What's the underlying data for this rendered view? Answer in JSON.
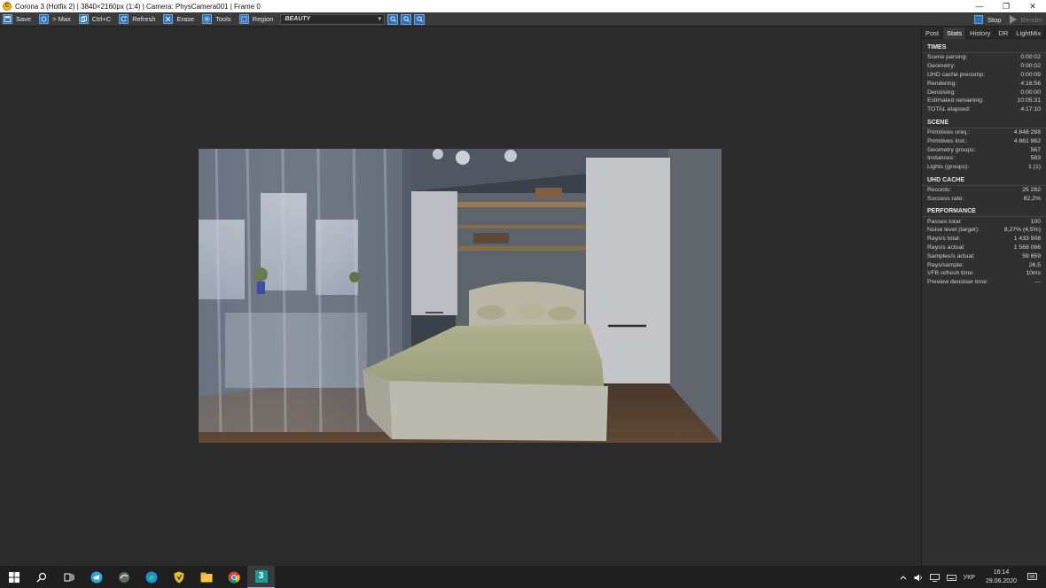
{
  "window": {
    "title": "Corona 3 (Hotfix 2) | 3840×2160px (1:4) | Camera: PhysCamera001 | Frame 0",
    "app_icon_glyph": "C",
    "controls": {
      "minimize": "—",
      "maximize": "❐",
      "close": "✕"
    }
  },
  "toolbar": {
    "save": "Save",
    "max": "> Max",
    "copy": "Ctrl+C",
    "refresh": "Refresh",
    "erase": "Erase",
    "tools": "Tools",
    "region": "Region",
    "pass": "BEAUTY",
    "stop": "Stop",
    "render": "Render",
    "icons": {
      "save": "save-icon",
      "max": "maximize-icon",
      "copy": "copy-icon",
      "refresh": "refresh-icon",
      "erase": "erase-icon",
      "tools": "gear-icon",
      "region": "region-icon"
    }
  },
  "panel": {
    "tabs": [
      "Post",
      "Stats",
      "History",
      "DR",
      "LightMix"
    ],
    "active_tab": "Stats",
    "sections": [
      {
        "title": "TIMES",
        "rows": [
          {
            "label": "Scene parsing:",
            "value": "0:00:02"
          },
          {
            "label": "Geometry:",
            "value": "0:00:02"
          },
          {
            "label": "UHD cache precomp:",
            "value": "0:00:09"
          },
          {
            "label": "Rendering:",
            "value": "4:16:56"
          },
          {
            "label": "Denoising:",
            "value": "0:00:00"
          },
          {
            "label": "Estimated remaining:",
            "value": "10:05:31"
          },
          {
            "label": "TOTAL elapsed:",
            "value": "4:17:10"
          }
        ]
      },
      {
        "title": "SCENE",
        "rows": [
          {
            "label": "Primitives uniq.:",
            "value": "4 848 298"
          },
          {
            "label": "Primitives inst.:",
            "value": "4 861 962"
          },
          {
            "label": "Geometry groups:",
            "value": "567"
          },
          {
            "label": "Instances:",
            "value": "583"
          },
          {
            "label": "Lights (groups):",
            "value": "1 (1)"
          }
        ]
      },
      {
        "title": "UHD CACHE",
        "rows": [
          {
            "label": "Records:",
            "value": "25 282"
          },
          {
            "label": "Success rate:",
            "value": "82,2%"
          }
        ]
      },
      {
        "title": "PERFORMANCE",
        "rows": [
          {
            "label": "Passes total:",
            "value": "100"
          },
          {
            "label": "Noise level (target):",
            "value": "8,27% (4,5%)"
          },
          {
            "label": "Rays/s total:",
            "value": "1 433 508"
          },
          {
            "label": "Rays/s actual:",
            "value": "1 568 066"
          },
          {
            "label": "Samples/s actual:",
            "value": "59 659"
          },
          {
            "label": "Rays/sample:",
            "value": "26,5"
          },
          {
            "label": "VFB refresh time:",
            "value": "10ms"
          },
          {
            "label": "Preview denoiser time:",
            "value": "---"
          }
        ]
      }
    ]
  },
  "taskbar": {
    "apps": [
      {
        "name": "windows-start-icon",
        "active": false
      },
      {
        "name": "search-icon",
        "active": false
      },
      {
        "name": "task-view-icon",
        "active": false
      },
      {
        "name": "telegram-icon",
        "active": false
      },
      {
        "name": "swirl-app-icon",
        "active": false
      },
      {
        "name": "edge-browser-icon",
        "active": false
      },
      {
        "name": "shield-app-icon",
        "active": false
      },
      {
        "name": "file-explorer-icon",
        "active": false
      },
      {
        "name": "chrome-browser-icon",
        "active": false
      },
      {
        "name": "3dsmax-icon",
        "active": true
      }
    ],
    "language": "УКР",
    "time": "16:14",
    "date": "29.06.2020",
    "max_app_glyph": "3"
  }
}
